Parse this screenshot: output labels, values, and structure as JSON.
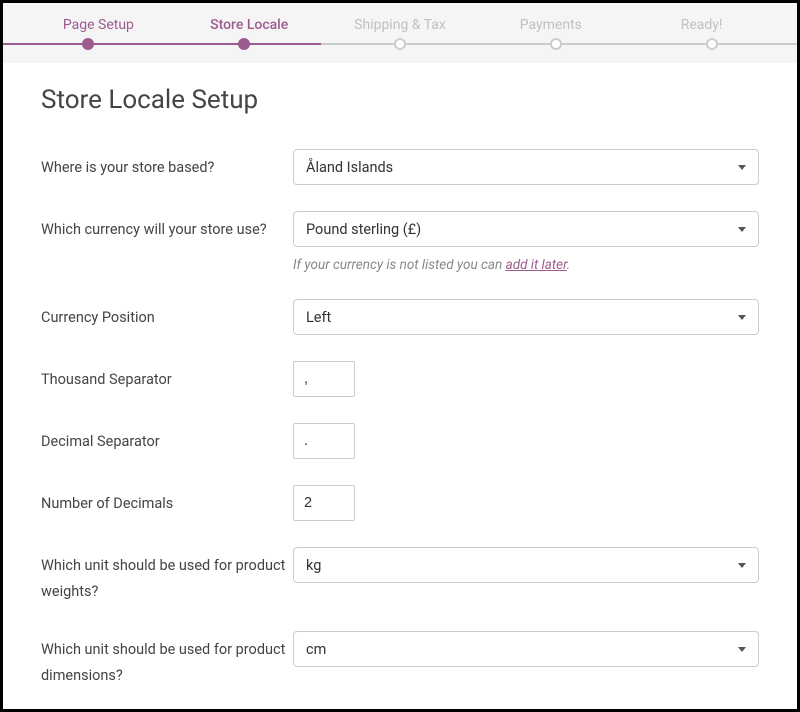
{
  "wizard": {
    "steps": [
      {
        "label": "Page Setup",
        "state": "past"
      },
      {
        "label": "Store Locale",
        "state": "current"
      },
      {
        "label": "Shipping & Tax",
        "state": "future"
      },
      {
        "label": "Payments",
        "state": "future"
      },
      {
        "label": "Ready!",
        "state": "future"
      }
    ]
  },
  "page": {
    "title": "Store Locale Setup"
  },
  "form": {
    "location": {
      "label": "Where is your store based?",
      "value": "Åland Islands"
    },
    "currency": {
      "label": "Which currency will your store use?",
      "value": "Pound sterling (£)",
      "helper_prefix": "If your currency is not listed you can ",
      "helper_link": "add it later",
      "helper_suffix": "."
    },
    "currency_position": {
      "label": "Currency Position",
      "value": "Left"
    },
    "thousand_separator": {
      "label": "Thousand Separator",
      "value": ","
    },
    "decimal_separator": {
      "label": "Decimal Separator",
      "value": "."
    },
    "number_decimals": {
      "label": "Number of Decimals",
      "value": "2"
    },
    "weight_unit": {
      "label": "Which unit should be used for product weights?",
      "value": "kg"
    },
    "dimension_unit": {
      "label": "Which unit should be used for product dimensions?",
      "value": "cm"
    }
  }
}
